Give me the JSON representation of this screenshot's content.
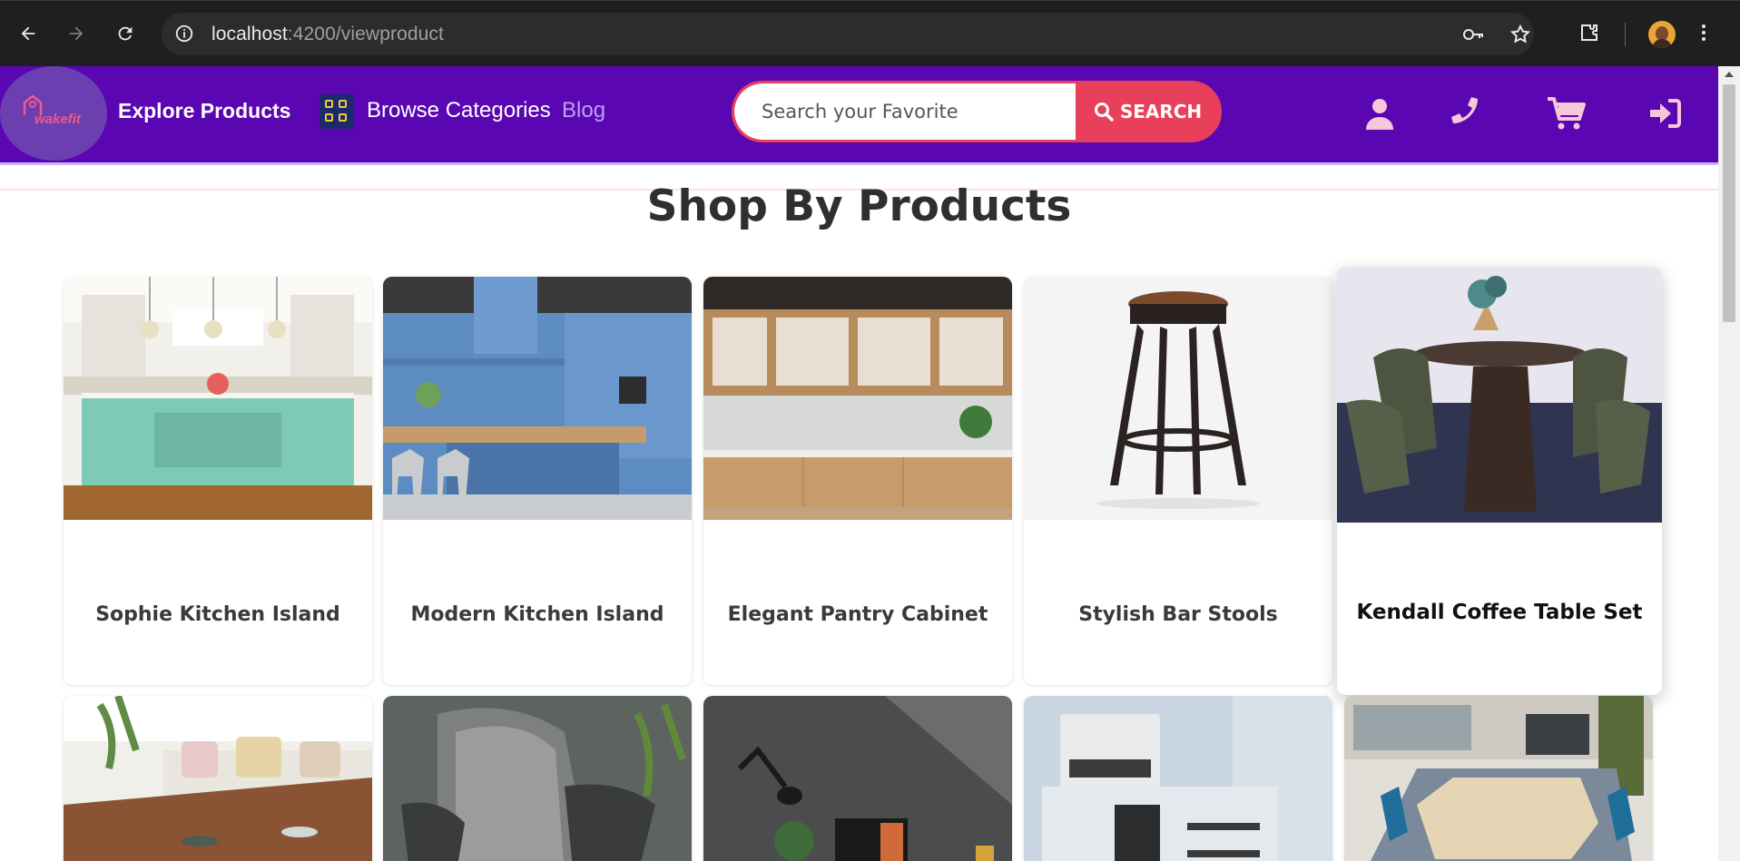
{
  "browser": {
    "url_host": "localhost",
    "url_rest": ":4200/viewproduct"
  },
  "header": {
    "logo_text": "wakefit",
    "explore_label": "Explore Products",
    "browse_label": "Browse Categories",
    "blog_label": "Blog",
    "search_placeholder": "Search your Favorite",
    "search_button_label": "SEARCH",
    "icons": [
      "user-icon",
      "phone-icon",
      "cart-icon",
      "login-icon"
    ]
  },
  "main": {
    "title": "Shop By Products",
    "products": [
      {
        "name": "Sophie Kitchen Island"
      },
      {
        "name": "Modern Kitchen Island"
      },
      {
        "name": "Elegant Pantry Cabinet"
      },
      {
        "name": "Stylish Bar Stools"
      },
      {
        "name": "Kendall Coffee Table Set"
      }
    ]
  },
  "colors": {
    "header_bg": "#5a06b3",
    "search_accent": "#e8405a",
    "icon_pink": "#f6c7d8"
  }
}
